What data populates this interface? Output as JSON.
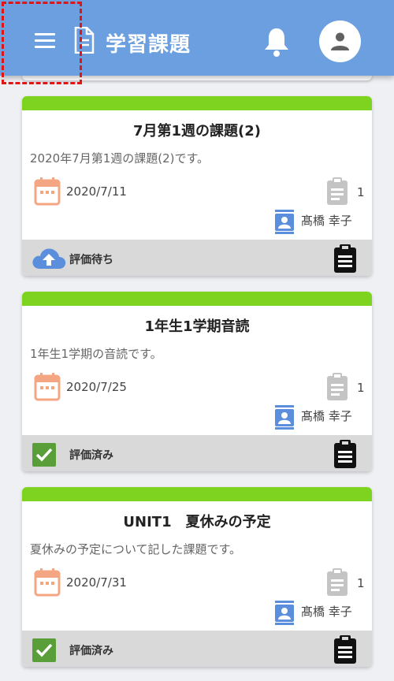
{
  "header": {
    "title": "学習課題",
    "menu_icon": "hamburger-menu-icon",
    "page_icon": "document-icon",
    "notification_icon": "bell-icon",
    "account_icon": "account-icon"
  },
  "colors": {
    "header_bg": "#6b9fdf",
    "card_accent": "#7ed321",
    "date_icon": "#f4a582",
    "pending_icon": "#5b8fdb",
    "done_icon": "#5a9e3a"
  },
  "assignments": [
    {
      "title": "7月第1週の課題(2)",
      "description": "2020年7月第1週の課題(2)です。",
      "date": "2020/7/11",
      "count": "1",
      "teacher": "髙橋 幸子",
      "status": "評価待ち",
      "status_icon": "cloud-upload-icon"
    },
    {
      "title": "1年生1学期音読",
      "description": "1年生1学期の音読です。",
      "date": "2020/7/25",
      "count": "1",
      "teacher": "髙橋 幸子",
      "status": "評価済み",
      "status_icon": "checkbox-checked-icon"
    },
    {
      "title": "UNIT1　夏休みの予定",
      "description": "夏休みの予定について記した課題です。",
      "date": "2020/7/31",
      "count": "1",
      "teacher": "髙橋 幸子",
      "status": "評価済み",
      "status_icon": "checkbox-checked-icon"
    }
  ]
}
